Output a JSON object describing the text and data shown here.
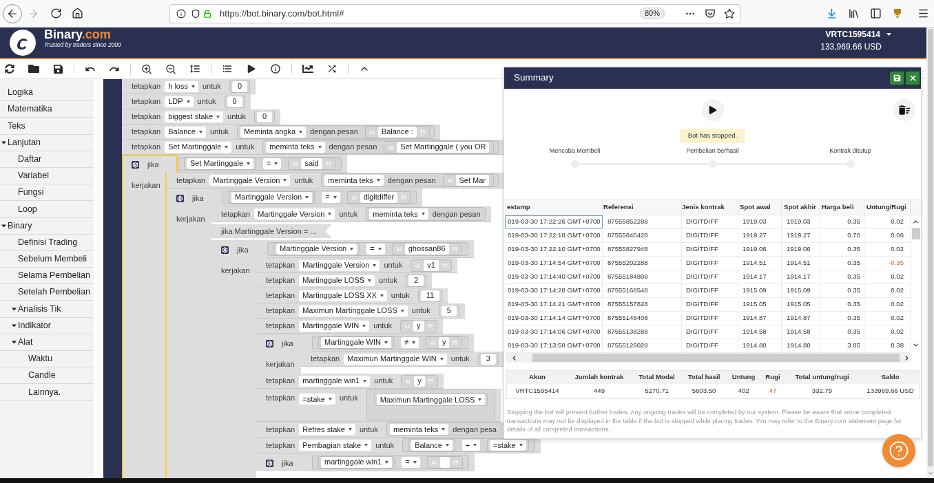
{
  "browser": {
    "url": "https://bot.binary.com/bot.html#",
    "zoom": "80%"
  },
  "header": {
    "brand": "Binary",
    "brand_suffix": ".com",
    "tagline": "Trusted by traders since 2000",
    "account_id": "VRTC1595414",
    "balance": "133,969.66 USD"
  },
  "sidebar": {
    "items": [
      {
        "label": "Logika"
      },
      {
        "label": "Matematika"
      },
      {
        "label": "Teks"
      },
      {
        "label": "Lanjutan",
        "expanded": true,
        "children": [
          {
            "label": "Daftar"
          },
          {
            "label": "Variabel"
          },
          {
            "label": "Fungsi"
          },
          {
            "label": "Loop"
          }
        ]
      },
      {
        "label": "Binary",
        "expanded": true,
        "children": [
          {
            "label": "Definisi Trading"
          },
          {
            "label": "Sebelum Membeli"
          },
          {
            "label": "Selama Pembelian"
          },
          {
            "label": "Setelah Pembelian"
          },
          {
            "label": "Analisis Tik",
            "expanded": true
          },
          {
            "label": "Indikator",
            "expanded": true
          },
          {
            "label": "Alat",
            "expanded": true,
            "children": [
              {
                "label": "Waktu"
              },
              {
                "label": "Candle"
              },
              {
                "label": "Lainnya."
              }
            ]
          }
        ]
      }
    ]
  },
  "workspace": {
    "blocks": [
      {
        "kind": "set",
        "selected": false,
        "label": "tetapkan",
        "variable": "h loss",
        "to": "untuk",
        "value": {
          "kind": "number",
          "text": "0"
        }
      },
      {
        "kind": "set",
        "selected": false,
        "label": "tetapkan",
        "variable": "LDP",
        "to": "untuk",
        "value": {
          "kind": "number",
          "text": "0"
        }
      },
      {
        "kind": "set",
        "selected": false,
        "label": "tetapkan",
        "variable": "biggest stake",
        "to": "untuk",
        "value": {
          "kind": "number",
          "text": "0"
        }
      },
      {
        "kind": "set",
        "selected": false,
        "label": "tetapkan",
        "variable": "Balance",
        "to": "untuk",
        "value": {
          "kind": "prompt",
          "type": "Meminta angka",
          "label": "dengan pesan",
          "message": {
            "kind": "string",
            "text": "Balance :"
          }
        }
      },
      {
        "kind": "set",
        "selected": false,
        "label": "tetapkan",
        "variable": "Set Martinggale",
        "to": "untuk",
        "value": {
          "kind": "prompt",
          "type": "meminta teks",
          "label": "dengan pesan",
          "message": {
            "kind": "string",
            "text": "Set Martinggale ( you OR",
            "closed": false
          }
        }
      },
      {
        "kind": "if",
        "selected": true,
        "label": "jika",
        "condition": {
          "kind": "operation",
          "left": {
            "kind": "variable",
            "text": "Set Martinggale"
          },
          "op": "=",
          "right": {
            "kind": "string",
            "text": "said"
          }
        },
        "do_label": "kerjakan",
        "children": [
          {
            "kind": "set",
            "selected": false,
            "label": "tetapkan",
            "variable": "Martinggale Version",
            "to": "untuk",
            "value": {
              "kind": "prompt",
              "type": "meminta teks",
              "label": "dengan pesan",
              "message": {
                "kind": "string",
                "text": "Set Mar",
                "closed": false
              }
            }
          },
          {
            "kind": "if",
            "selected": false,
            "label": "jika",
            "condition": {
              "kind": "operation",
              "left": {
                "kind": "variable",
                "text": "Martinggale Version"
              },
              "op": "=",
              "right": {
                "kind": "string",
                "text": "digitdiffer"
              }
            },
            "do_label": "kerjakan",
            "children": [
              {
                "kind": "set",
                "selected": false,
                "label": "tetapkan",
                "variable": "Martinggale Version",
                "to": "untuk",
                "value": {
                  "kind": "prompt",
                  "type": "meminta teks",
                  "label": "dengan pesan"
                }
              },
              {
                "kind": "collapsed",
                "selected": false,
                "text": "jika Martinggale Version = ..."
              },
              {
                "kind": "if",
                "selected": false,
                "label": "jika",
                "condition": {
                  "kind": "operation",
                  "left": {
                    "kind": "variable",
                    "text": "Martinggale Version"
                  },
                  "op": "=",
                  "right": {
                    "kind": "string",
                    "text": "ghossan86"
                  }
                },
                "do_label": "kerjakan",
                "children": [
                  {
                    "kind": "set",
                    "selected": false,
                    "label": "tetapkan",
                    "variable": "Martinggale Version",
                    "to": "untuk",
                    "value": {
                      "kind": "string",
                      "text": "v1"
                    }
                  },
                  {
                    "kind": "set",
                    "selected": false,
                    "label": "tetapkan",
                    "variable": "Martinggale LOSS",
                    "to": "untuk",
                    "value": {
                      "kind": "number",
                      "text": "2"
                    }
                  },
                  {
                    "kind": "set",
                    "selected": false,
                    "label": "tetapkan",
                    "variable": "Martinggale LOSS XX",
                    "to": "untuk",
                    "value": {
                      "kind": "number",
                      "text": "11"
                    }
                  },
                  {
                    "kind": "set",
                    "selected": false,
                    "label": "tetapkan",
                    "variable": "Maximun Martinggale LOSS",
                    "to": "untuk",
                    "value": {
                      "kind": "number",
                      "text": "5"
                    }
                  },
                  {
                    "kind": "set",
                    "selected": false,
                    "label": "tetapkan",
                    "variable": "Martinggale WIN",
                    "to": "untuk",
                    "value": {
                      "kind": "string",
                      "text": "y"
                    }
                  },
                  {
                    "kind": "if",
                    "selected": false,
                    "label": "jika",
                    "condition": {
                      "kind": "operation",
                      "left": {
                        "kind": "variable",
                        "text": "Martinggale WIN"
                      },
                      "op": "≠",
                      "right": {
                        "kind": "string",
                        "text": "y"
                      }
                    },
                    "do_label": "kerjakan",
                    "children": [
                      {
                        "kind": "set",
                        "selected": false,
                        "label": "tetapkan",
                        "variable": "Maximun Martinggale WIN",
                        "to": "untuk",
                        "value": {
                          "kind": "number",
                          "text": "3"
                        }
                      }
                    ]
                  },
                  {
                    "kind": "set",
                    "selected": false,
                    "label": "tetapkan",
                    "variable": "martinggale win1",
                    "to": "untuk",
                    "value": {
                      "kind": "string",
                      "text": "y"
                    }
                  },
                  {
                    "kind": "set",
                    "selected": false,
                    "label": "tetapkan",
                    "variable": "=stake",
                    "to": "untuk",
                    "value": {
                      "kind": "group",
                      "items": [
                        {
                          "kind": "variable",
                          "text": "Maximun Martinggale LOSS"
                        }
                      ]
                    }
                  },
                  {
                    "kind": "set",
                    "selected": false,
                    "label": "tetapkan",
                    "variable": "Refres stake",
                    "to": "untuk",
                    "value": {
                      "kind": "prompt",
                      "type": "meminta teks",
                      "label": "dengan pesa"
                    }
                  },
                  {
                    "kind": "set",
                    "selected": false,
                    "label": "tetapkan",
                    "variable": "Pembagian stake",
                    "to": "untuk",
                    "value": {
                      "kind": "operation",
                      "left": {
                        "kind": "variable",
                        "text": "Balance"
                      },
                      "op": "÷",
                      "right": {
                        "kind": "variable",
                        "text": "=stake"
                      }
                    }
                  },
                  {
                    "kind": "if",
                    "selected": false,
                    "label": "jika",
                    "condition": {
                      "kind": "operation",
                      "left": {
                        "kind": "variable",
                        "text": "martinggale win1"
                      },
                      "op": "=",
                      "right": {
                        "kind": "string"
                      }
                    }
                  }
                ]
              }
            ]
          }
        ]
      }
    ]
  },
  "summary": {
    "title": "Summary",
    "status": "Bot has stopped.",
    "steps": [
      {
        "label": "Mencoba Membeli",
        "active": false
      },
      {
        "label": "Pembelian berhasil",
        "active": false
      },
      {
        "label": "Kontrak ditutup",
        "active": false
      }
    ],
    "trades": {
      "columns": [
        "estamp",
        "Referensi",
        "Jenis kontrak",
        "Spot awal",
        "Spot akhir",
        "Harga beli",
        "Untung/Rugi"
      ],
      "rows": [
        {
          "selected": true,
          "negative": false,
          "cells": [
            "019-03-30 17:22:26 GMT+0700",
            "87555852288",
            "DIGITDIFF",
            "1919.03",
            "1919.03",
            "0.35",
            "0.02"
          ]
        },
        {
          "selected": false,
          "negative": false,
          "cells": [
            "019-03-30 17:22:18 GMT+0700",
            "87555840428",
            "DIGITDIFF",
            "1919.27",
            "1919.27",
            "0.70",
            "0.06"
          ]
        },
        {
          "selected": false,
          "negative": false,
          "cells": [
            "019-03-30 17:22:10 GMT+0700",
            "87555827948",
            "DIGITDIFF",
            "1919.06",
            "1919.06",
            "0.35",
            "0.02"
          ]
        },
        {
          "selected": false,
          "negative": true,
          "cells": [
            "019-03-30 17:14:54 GMT+0700",
            "87555202288",
            "DIGITDIFF",
            "1914.51",
            "1914.51",
            "0.35",
            "-0.35"
          ]
        },
        {
          "selected": false,
          "negative": false,
          "cells": [
            "019-03-30 17:14:40 GMT+0700",
            "87555184808",
            "DIGITDIFF",
            "1914.17",
            "1914.17",
            "0.35",
            "0.02"
          ]
        },
        {
          "selected": false,
          "negative": false,
          "cells": [
            "019-03-30 17:14:28 GMT+0700",
            "87555168548",
            "DIGITDIFF",
            "1915.09",
            "1915.09",
            "0.35",
            "0.02"
          ]
        },
        {
          "selected": false,
          "negative": false,
          "cells": [
            "019-03-30 17:14:21 GMT+0700",
            "87555157828",
            "DIGITDIFF",
            "1915.05",
            "1915.05",
            "0.35",
            "0.02"
          ]
        },
        {
          "selected": false,
          "negative": false,
          "cells": [
            "019-03-30 17:14:14 GMT+0700",
            "87555148408",
            "DIGITDIFF",
            "1914.87",
            "1914.87",
            "0.35",
            "0.02"
          ]
        },
        {
          "selected": false,
          "negative": false,
          "cells": [
            "019-03-30 17:14:06 GMT+0700",
            "87555138288",
            "DIGITDIFF",
            "1914.58",
            "1914.58",
            "0.35",
            "0.02"
          ]
        },
        {
          "selected": false,
          "negative": false,
          "cells": [
            "019-03-30 17:13:58 GMT+0700",
            "87555126028",
            "DIGITDIFF",
            "1914.80",
            "1914.80",
            "3.85",
            "0.38"
          ]
        }
      ]
    },
    "totals": [
      {
        "label": "Akun",
        "value": "VRTC1595414",
        "negative": false
      },
      {
        "label": "Jumlah kontrak",
        "value": "449",
        "negative": false
      },
      {
        "label": "Total Modal",
        "value": "5270.71",
        "negative": false
      },
      {
        "label": "Total hasil",
        "value": "5603.50",
        "negative": false
      },
      {
        "label": "Untung",
        "value": "402",
        "negative": false
      },
      {
        "label": "Rugi",
        "value": "47",
        "negative": true
      },
      {
        "label": "Total untung/rugi",
        "value": "332.79",
        "negative": false
      },
      {
        "label": "Saldo",
        "value": "133969.66 USD",
        "negative": false
      }
    ],
    "note": "Stopping the bot will prevent further trades. Any ongoing trades will be completed by our system. Please be aware that some completed transactions may not be displayed in the table if the bot is stopped while placing trades. You may refer to the Binary.com statement page for details of all completed transactions."
  }
}
